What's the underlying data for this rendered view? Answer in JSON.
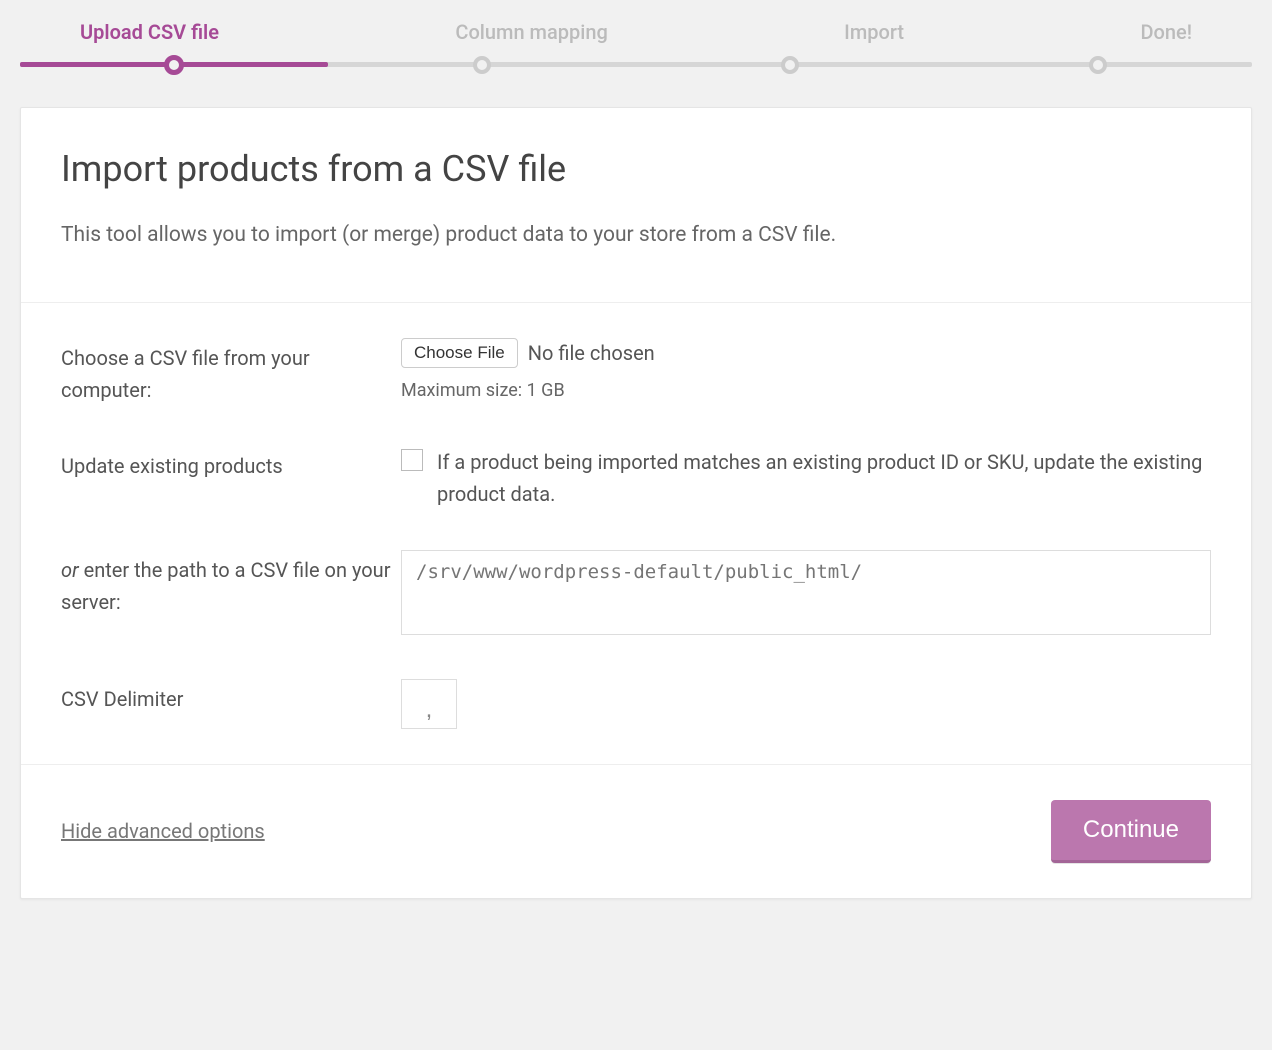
{
  "progress": {
    "steps": [
      {
        "label": "Upload CSV file",
        "active": true
      },
      {
        "label": "Column mapping",
        "active": false
      },
      {
        "label": "Import",
        "active": false
      },
      {
        "label": "Done!",
        "active": false
      }
    ]
  },
  "header": {
    "title": "Import products from a CSV file",
    "subtitle": "This tool allows you to import (or merge) product data to your store from a CSV file."
  },
  "form": {
    "choose_label": "Choose a CSV file from your computer:",
    "choose_btn": "Choose File",
    "file_status": "No file chosen",
    "max_size": "Maximum size: 1 GB",
    "update_label": "Update existing products",
    "update_desc": "If a product being imported matches an existing product ID or SKU, update the existing product data.",
    "path_label_prefix": "or",
    "path_label_rest": " enter the path to a CSV file on your server:",
    "path_placeholder": "/srv/www/wordpress-default/public_html/",
    "delimiter_label": "CSV Delimiter",
    "delimiter_value": ","
  },
  "footer": {
    "advanced_link": "Hide advanced options",
    "continue_btn": "Continue"
  }
}
